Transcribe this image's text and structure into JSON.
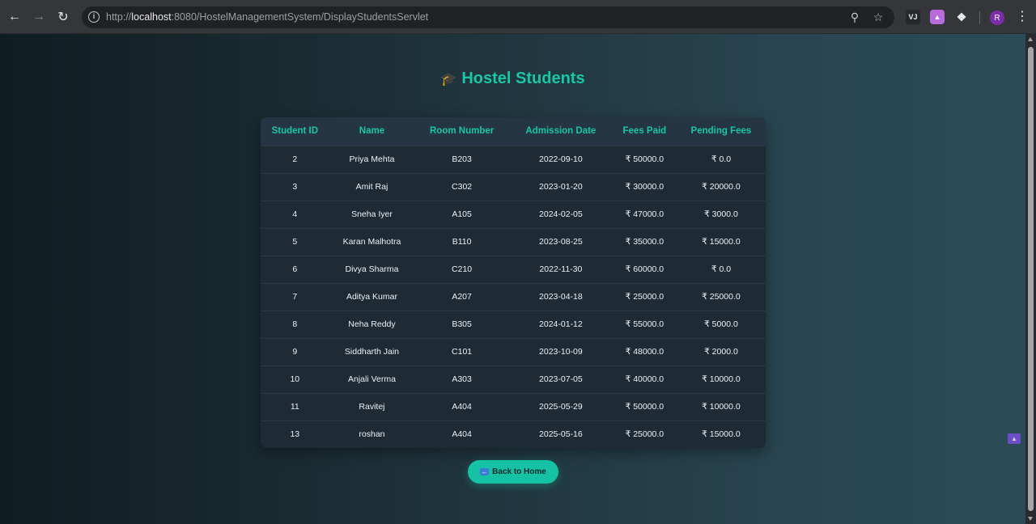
{
  "browser": {
    "url_scheme": "http://",
    "url_host": "localhost",
    "url_rest": ":8080/HostelManagementSystem/DisplayStudentsServlet",
    "extension_label": "VJ",
    "avatar_letter": "R"
  },
  "page": {
    "title": "Hostel Students",
    "title_icon": "🎓"
  },
  "table": {
    "headers": [
      "Student ID",
      "Name",
      "Room Number",
      "Admission Date",
      "Fees Paid",
      "Pending Fees"
    ],
    "rows": [
      [
        "2",
        "Priya Mehta",
        "B203",
        "2022-09-10",
        "₹ 50000.0",
        "₹ 0.0"
      ],
      [
        "3",
        "Amit Raj",
        "C302",
        "2023-01-20",
        "₹ 30000.0",
        "₹ 20000.0"
      ],
      [
        "4",
        "Sneha Iyer",
        "A105",
        "2024-02-05",
        "₹ 47000.0",
        "₹ 3000.0"
      ],
      [
        "5",
        "Karan Malhotra",
        "B110",
        "2023-08-25",
        "₹ 35000.0",
        "₹ 15000.0"
      ],
      [
        "6",
        "Divya Sharma",
        "C210",
        "2022-11-30",
        "₹ 60000.0",
        "₹ 0.0"
      ],
      [
        "7",
        "Aditya Kumar",
        "A207",
        "2023-04-18",
        "₹ 25000.0",
        "₹ 25000.0"
      ],
      [
        "8",
        "Neha Reddy",
        "B305",
        "2024-01-12",
        "₹ 55000.0",
        "₹ 5000.0"
      ],
      [
        "9",
        "Siddharth Jain",
        "C101",
        "2023-10-09",
        "₹ 48000.0",
        "₹ 2000.0"
      ],
      [
        "10",
        "Anjali Verma",
        "A303",
        "2023-07-05",
        "₹ 40000.0",
        "₹ 10000.0"
      ],
      [
        "11",
        "Ravitej",
        "A404",
        "2025-05-29",
        "₹ 50000.0",
        "₹ 10000.0"
      ],
      [
        "13",
        "roshan",
        "A404",
        "2025-05-16",
        "₹ 25000.0",
        "₹ 15000.0"
      ]
    ]
  },
  "back_button": {
    "label": "Back to Home"
  },
  "colors": {
    "accent": "#19c7a6",
    "button": "#16c2a4"
  }
}
